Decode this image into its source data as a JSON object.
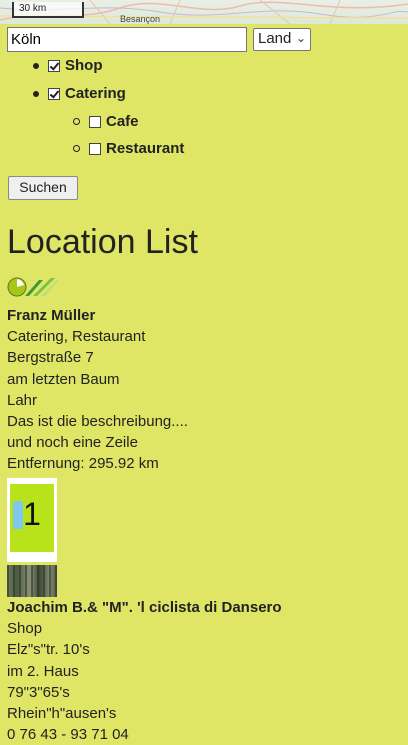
{
  "map": {
    "scale_label": "30 km",
    "place_label": "Besançon"
  },
  "search": {
    "value": "Köln",
    "country_select": "Land"
  },
  "categories": [
    {
      "label": "Shop",
      "checked": true
    },
    {
      "label": "Catering",
      "checked": true,
      "children": [
        {
          "label": "Cafe",
          "checked": false
        },
        {
          "label": "Restaurant",
          "checked": false
        }
      ]
    }
  ],
  "search_button": "Suchen",
  "page_title": "Location List",
  "locations": [
    {
      "name": "Franz Müller",
      "categories": "Catering, Restaurant",
      "street": "Bergstraße 7",
      "address_extra": "am letzten Baum",
      "city": "Lahr",
      "description": "Das ist die beschreibung....",
      "description_2": "und noch eine Zeile",
      "distance": "Entfernung: 295.92 km",
      "marker_number": "1"
    },
    {
      "name": "Joachim B.& \"M\". 'l ciclista di Dansero",
      "categories": "Shop",
      "street": "Elz\"s\"tr. 10's",
      "address_extra": "im 2. Haus",
      "zip": "79\"3\"65's",
      "city": "Rhein\"h\"ausen's",
      "phone": "0 76 43 - 93 71 04"
    }
  ],
  "colors": {
    "background": "#dfe665",
    "marker_fill": "#b8e21a"
  }
}
